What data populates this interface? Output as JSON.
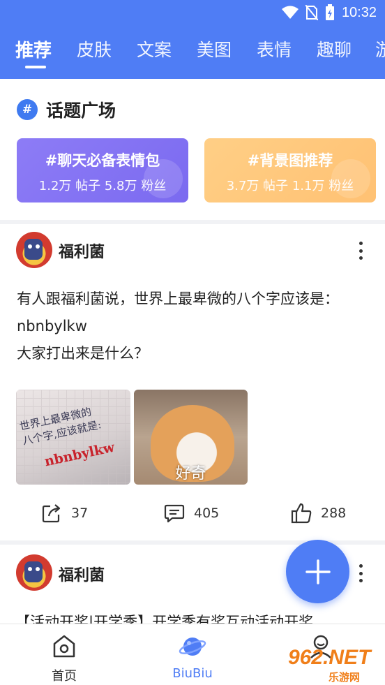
{
  "status_bar": {
    "time": "10:32"
  },
  "tabs": [
    {
      "label": "推荐",
      "active": true
    },
    {
      "label": "皮肤"
    },
    {
      "label": "文案"
    },
    {
      "label": "美图"
    },
    {
      "label": "表情"
    },
    {
      "label": "趣聊"
    },
    {
      "label": "游"
    }
  ],
  "topic_square": {
    "title": "话题广场",
    "cards": [
      {
        "name": "#聊天必备表情包",
        "stats": "1.2万 帖子   5.8万 粉丝"
      },
      {
        "name": "#背景图推荐",
        "stats": "3.7万 帖子   1.1万 粉丝"
      }
    ]
  },
  "posts": [
    {
      "author": "福利菌",
      "lines": [
        "有人跟福利菌说，世界上最卑微的八个字应该是：",
        "nbnbylkw",
        "大家打出来是什么？"
      ],
      "image1_text1": "世界上最卑微的\n八个字,应该就是:",
      "image1_text2": "nbnbylkw",
      "image2_caption": "好奇",
      "shares": "37",
      "comments": "405",
      "likes": "288"
    },
    {
      "author": "福利菌",
      "preview": "【活动开奖|开学季】开学季有奖互动活动开奖"
    }
  ],
  "bottom_nav": [
    {
      "label": "首页",
      "icon": "home-icon"
    },
    {
      "label": "BiuBiu",
      "icon": "planet-icon",
      "active": true
    },
    {
      "label": "",
      "icon": "profile-icon"
    }
  ],
  "watermark": {
    "text": "962.NET",
    "sub": "乐游网"
  },
  "colors": {
    "primary": "#4f7df5",
    "purple_card": "#8d7cf6",
    "orange_card": "#ffc173"
  }
}
